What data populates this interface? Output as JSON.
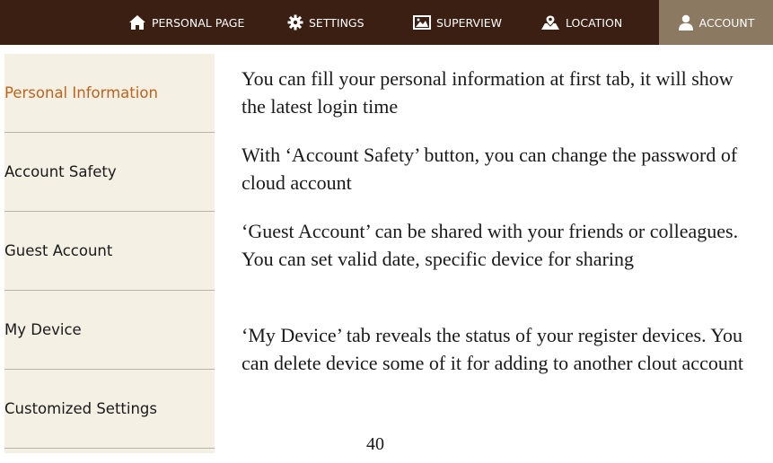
{
  "nav": {
    "items": [
      {
        "label": "PERSONAL PAGE",
        "icon": "home-icon"
      },
      {
        "label": "SETTINGS",
        "icon": "gear-icon"
      },
      {
        "label": "SUPERVIEW",
        "icon": "image-icon"
      },
      {
        "label": "LOCATION",
        "icon": "map-location-icon"
      },
      {
        "label": "ACCOUNT",
        "icon": "user-icon",
        "active": true
      }
    ]
  },
  "sidebar": {
    "items": [
      {
        "label": "Personal Information",
        "active": true
      },
      {
        "label": "Account Safety"
      },
      {
        "label": "Guest Account"
      },
      {
        "label": "My Device"
      },
      {
        "label": "Customized Settings"
      }
    ]
  },
  "content": {
    "paragraphs": [
      "You can fill your personal information at first tab, it will show the latest login time",
      "With ‘Account Safety’ button, you can change the password of cloud account",
      "‘Guest Account’ can be shared with your friends or colleagues. You can set valid date, specific device for sharing",
      "‘My Device’ tab reveals the status of your register devices. You can delete device some of it for adding to another clout account"
    ]
  },
  "page_number": "40",
  "colors": {
    "topbar": "#3b1f12",
    "active_tab": "#8c7961",
    "sidebar_bg": "#f5f0e4",
    "sidebar_active_text": "#c0621c"
  }
}
